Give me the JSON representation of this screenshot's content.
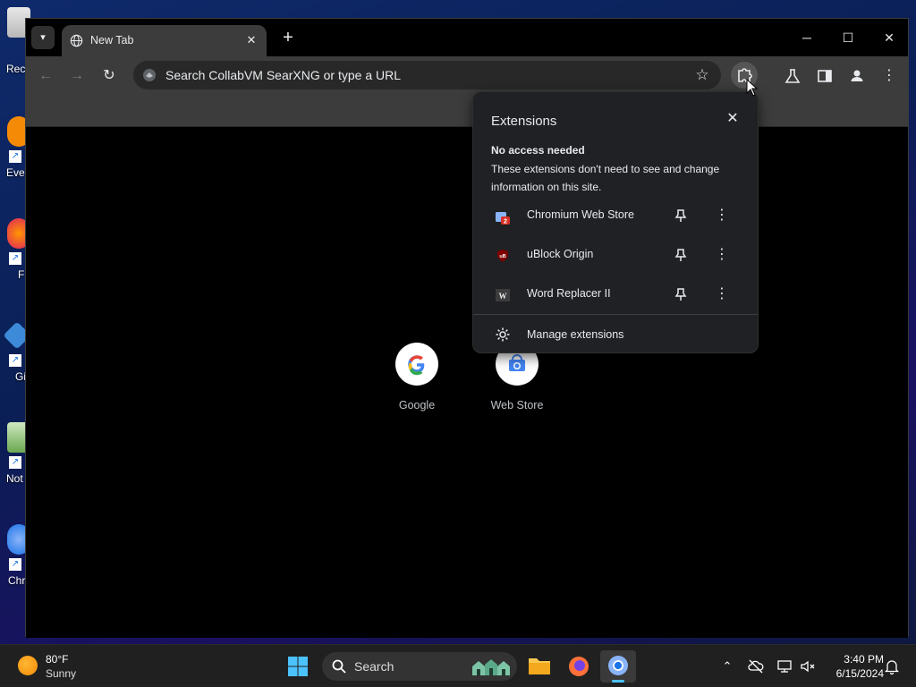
{
  "desktop": {
    "icons": [
      {
        "label": "Rec"
      },
      {
        "label": "Eve"
      },
      {
        "label": "F"
      },
      {
        "label": "Gi"
      },
      {
        "label": "Not"
      },
      {
        "label": "Chr"
      }
    ]
  },
  "browser": {
    "tab": {
      "title": "New Tab"
    },
    "omnibox": {
      "placeholder": "Search CollabVM SearXNG or type a URL"
    },
    "shortcuts": [
      {
        "label": "Google"
      },
      {
        "label": "Web Store"
      }
    ]
  },
  "extensions_popup": {
    "title": "Extensions",
    "section_title": "No access needed",
    "section_desc": "These extensions don't need to see and change information on this site.",
    "items": [
      {
        "name": "Chromium Web Store",
        "badge": "2"
      },
      {
        "name": "uBlock Origin"
      },
      {
        "name": "Word Replacer II"
      }
    ],
    "manage_label": "Manage extensions"
  },
  "taskbar": {
    "weather": {
      "temp": "80°F",
      "condition": "Sunny"
    },
    "search_label": "Search",
    "clock": {
      "time": "3:40 PM",
      "date": "6/15/2024"
    }
  },
  "colors": {
    "accent": "#4cc2ff",
    "popup_bg": "#202124",
    "toolbar_bg": "#3c3c3c"
  }
}
